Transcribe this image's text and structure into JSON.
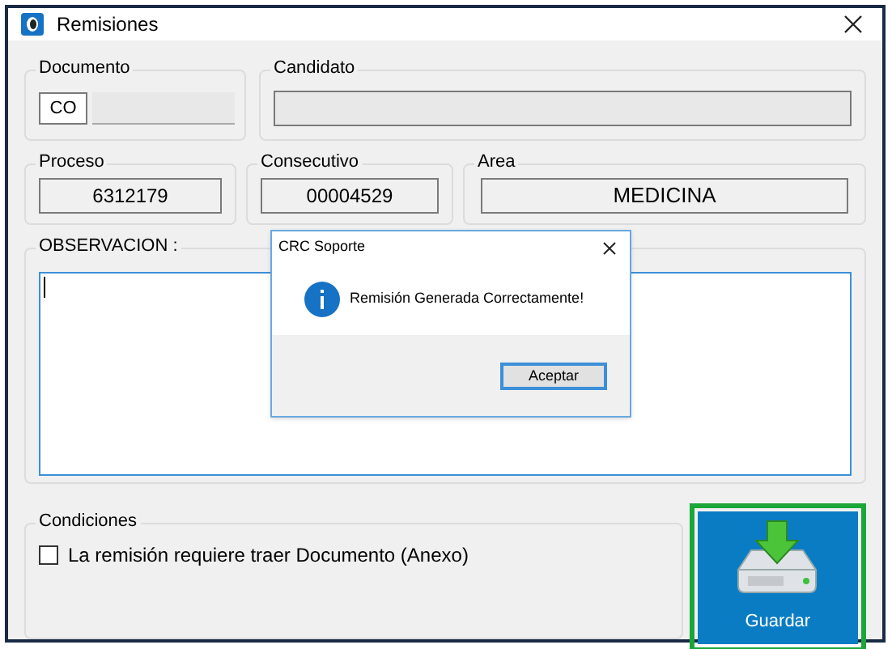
{
  "window": {
    "title": "Remisiones"
  },
  "documento": {
    "label": "Documento",
    "type": "CO"
  },
  "candidato": {
    "label": "Candidato"
  },
  "proceso": {
    "label": "Proceso",
    "value": "6312179"
  },
  "consecutivo": {
    "label": "Consecutivo",
    "value": "00004529"
  },
  "area": {
    "label": "Area",
    "value": "MEDICINA"
  },
  "observacion": {
    "label": "OBSERVACION :"
  },
  "condiciones": {
    "label": "Condiciones",
    "checkbox": {
      "label": "La remisión requiere traer Documento (Anexo)",
      "checked": false
    }
  },
  "save_button": {
    "label": "Guardar"
  },
  "dialog": {
    "title": "CRC Soporte",
    "message": "Remisión Generada Correctamente!",
    "button": "Aceptar"
  }
}
